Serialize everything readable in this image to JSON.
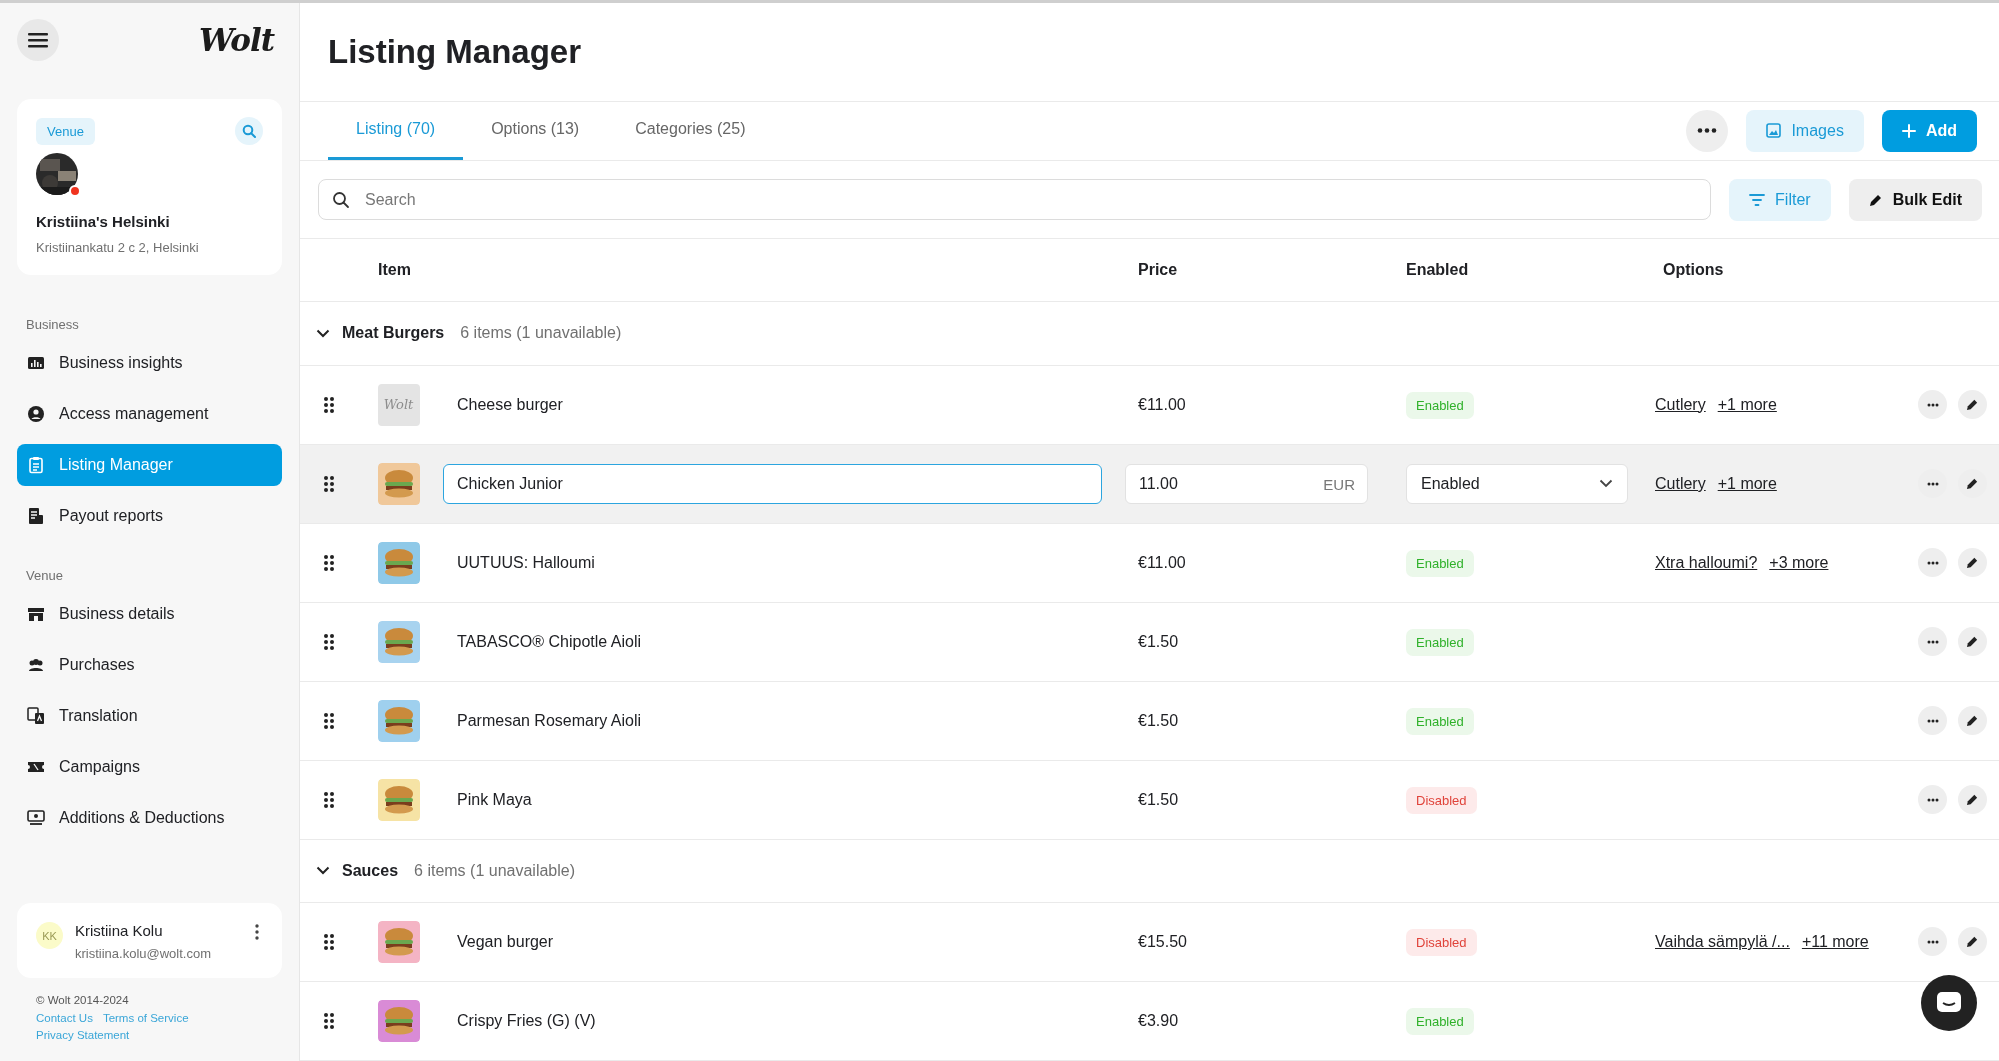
{
  "sidebar": {
    "logo": "Wolt",
    "venue_card": {
      "chip": "Venue",
      "name": "Kristiina's Helsinki",
      "address": "Kristiinankatu 2 c 2, Helsinki"
    },
    "sections": [
      {
        "title": "Business",
        "items": [
          {
            "label": "Business insights",
            "selected": false
          },
          {
            "label": "Access management",
            "selected": false
          },
          {
            "label": "Listing Manager",
            "selected": true
          },
          {
            "label": "Payout reports",
            "selected": false
          }
        ]
      },
      {
        "title": "Venue",
        "items": [
          {
            "label": "Business details",
            "selected": false
          },
          {
            "label": "Purchases",
            "selected": false
          },
          {
            "label": "Translation",
            "selected": false
          },
          {
            "label": "Campaigns",
            "selected": false
          },
          {
            "label": "Additions & Deductions",
            "selected": false
          }
        ]
      }
    ],
    "user": {
      "initials": "KK",
      "name": "Kristiina Kolu",
      "email": "kristiina.kolu@wolt.com"
    },
    "footer": {
      "copyright": "© Wolt 2014-2024",
      "links": [
        "Contact Us",
        "Terms of Service",
        "Privacy Statement"
      ]
    }
  },
  "page": {
    "title": "Listing Manager",
    "tabs": [
      {
        "label": "Listing (70)",
        "selected": true
      },
      {
        "label": "Options (13)",
        "selected": false
      },
      {
        "label": "Categories (25)",
        "selected": false
      }
    ],
    "actions": {
      "images": "Images",
      "add": "Add"
    },
    "search": {
      "placeholder": "Search"
    },
    "filter": "Filter",
    "bulk_edit": "Bulk Edit"
  },
  "table": {
    "columns": [
      "Item",
      "Price",
      "Enabled",
      "Options"
    ],
    "groups": [
      {
        "name": "Meat Burgers",
        "summary": "6 items (1 unavailable)",
        "expanded": true,
        "rows": [
          {
            "kind": "item",
            "thumb": {
              "kind": "logo",
              "text": "Wolt"
            },
            "name": "Cheese burger",
            "price": "€11.00",
            "enabled": true,
            "status": "Enabled",
            "options": [
              "Cutlery",
              "+1 more"
            ],
            "actions": true
          },
          {
            "kind": "editing",
            "thumb": {
              "kind": "picture"
            },
            "actions": true,
            "name": "Chicken Junior",
            "price": "11.00",
            "currency": "EUR",
            "status": "Enabled",
            "options": [
              "Cutlery",
              "+1 more"
            ]
          },
          {
            "kind": "item",
            "thumb": {
              "kind": "picture"
            },
            "name": "UUTUUS: Halloumi",
            "price": "€11.00",
            "enabled": true,
            "status": "Enabled",
            "options": [
              "Xtra halloumi?",
              "+3 more"
            ],
            "actions": true
          },
          {
            "kind": "item",
            "thumb": {
              "kind": "picture"
            },
            "name": "TABASCO® Chipotle Aioli",
            "price": "€1.50",
            "enabled": true,
            "status": "Enabled",
            "options": [],
            "actions": true
          },
          {
            "kind": "item",
            "thumb": {
              "kind": "picture"
            },
            "name": "Parmesan Rosemary Aioli",
            "price": "€1.50",
            "enabled": true,
            "status": "Enabled",
            "options": [],
            "actions": true
          },
          {
            "kind": "item",
            "thumb": {
              "kind": "picture"
            },
            "name": "Pink Maya",
            "price": "€1.50",
            "enabled": false,
            "status": "Disabled",
            "options": [],
            "actions": true
          }
        ]
      },
      {
        "name": "Sauces",
        "summary": "6 items (1 unavailable)",
        "expanded": true,
        "rows": [
          {
            "kind": "item",
            "thumb": {
              "kind": "picture"
            },
            "name": "Vegan burger",
            "price": "€15.50",
            "enabled": false,
            "status": "Disabled",
            "options": [
              "Vaihda sämpylä /...",
              "+11 more"
            ],
            "actions": true
          },
          {
            "kind": "item",
            "thumb": {
              "kind": "picture"
            },
            "name": "Crispy Fries (G) (V)",
            "price": "€3.90",
            "enabled": true,
            "status": "Enabled",
            "options": [],
            "actions": false
          }
        ]
      }
    ]
  }
}
